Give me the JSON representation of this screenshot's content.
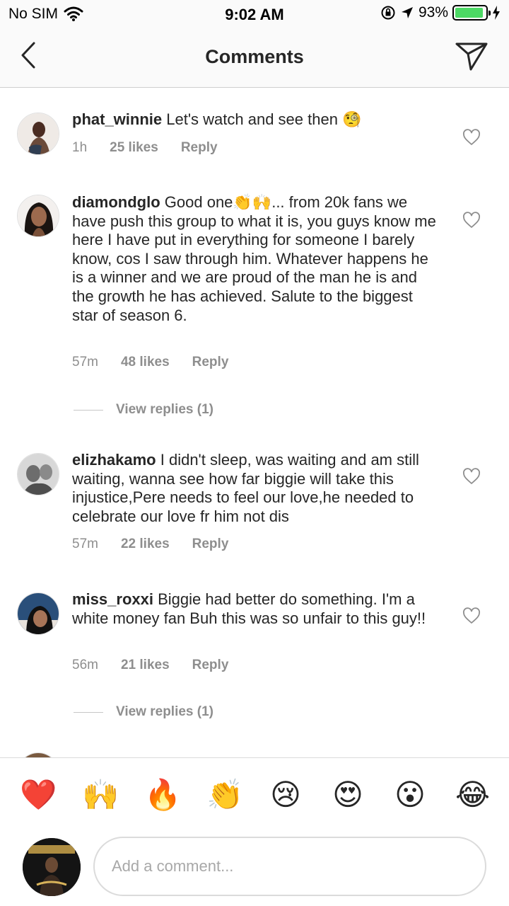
{
  "status_bar": {
    "carrier": "No SIM",
    "time": "9:02 AM",
    "battery": "93%",
    "battery_level": 0.93
  },
  "header": {
    "title": "Comments"
  },
  "comments": [
    {
      "username": "phat_winnie",
      "text": "Let's watch and see then 🧐",
      "time": "1h",
      "likes": "25 likes",
      "reply": "Reply"
    },
    {
      "username": "diamondglo",
      "text": "Good one👏🙌... from 20k fans we have push this group to what it is, you guys know me here I have put in everything for someone I barely know, cos I saw through him. Whatever happens he is a winner and we are proud of the man he is and the growth he has achieved. Salute to the biggest star of season 6.",
      "time": "57m",
      "likes": "48 likes",
      "reply": "Reply",
      "view_replies": "View replies (1)"
    },
    {
      "username": "elizhakamo",
      "text": "I didn't sleep, was waiting and am still waiting, wanna see how far biggie will take this injustice,Pere needs to feel our love,he needed to celebrate our love fr him not dis",
      "time": "57m",
      "likes": "22 likes",
      "reply": "Reply"
    },
    {
      "username": "miss_roxxi",
      "text": "Biggie had better do something. I'm a white money fan Buh this was so unfair to this guy!!",
      "time": "56m",
      "likes": "21 likes",
      "reply": "Reply",
      "view_replies": "View replies (1)"
    }
  ],
  "emoji_bar": [
    "❤️",
    "🙌",
    "🔥",
    "👏",
    "😢",
    "😍",
    "😮",
    "😂"
  ],
  "composer": {
    "placeholder": "Add a comment..."
  },
  "colors": {
    "text": "#262626",
    "secondary": "#8e8e8e",
    "battery": "#4cd964"
  }
}
